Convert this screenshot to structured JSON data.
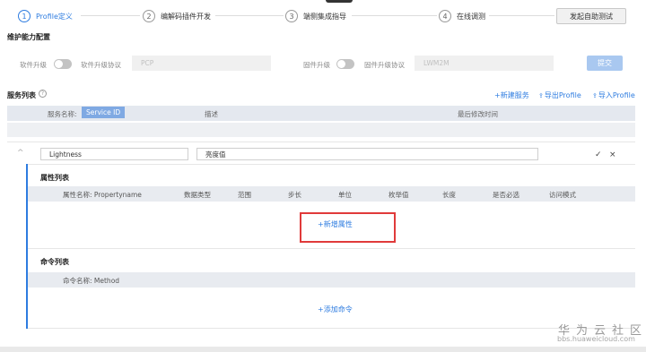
{
  "steps": [
    {
      "num": "1",
      "label": "Profile定义"
    },
    {
      "num": "2",
      "label": "编解码插件开发"
    },
    {
      "num": "3",
      "label": "端侧集成指导"
    },
    {
      "num": "4",
      "label": "在线调测"
    }
  ],
  "start_test_label": "发起自助测试",
  "maintenance": {
    "title": "维护能力配置",
    "software_upgrade_label": "软件升级",
    "software_protocol_label": "软件升级协议",
    "software_protocol_value": "PCP",
    "firmware_upgrade_label": "固件升级",
    "firmware_protocol_label": "固件升级协议",
    "firmware_protocol_value": "LWM2M",
    "submit_label": "提交"
  },
  "services": {
    "title": "服务列表",
    "help_icon": "help-circle-icon",
    "new_service": "+新建服务",
    "export_profile": "导出Profile",
    "import_profile": "导入Profile",
    "columns": {
      "service_name": "服务名称:",
      "service_id": "Service ID",
      "description": "描述",
      "last_modified": "最后修改时间"
    },
    "row": {
      "name_value": "Lightness",
      "desc_value": "亮度值"
    }
  },
  "properties": {
    "title": "属性列表",
    "columns": [
      "属性名称: Propertyname",
      "数据类型",
      "范围",
      "步长",
      "单位",
      "枚举值",
      "长度",
      "是否必选",
      "访问模式"
    ],
    "add_label": "+新增属性"
  },
  "commands": {
    "title": "命令列表",
    "column": "命令名称: Method",
    "add_label": "+添加命令"
  },
  "watermark": {
    "cn": "华为云社区",
    "url": "bbs.huaweicloud.com"
  },
  "colors": {
    "accent": "#2e7ce0",
    "highlight_box": "#e03a3a"
  }
}
